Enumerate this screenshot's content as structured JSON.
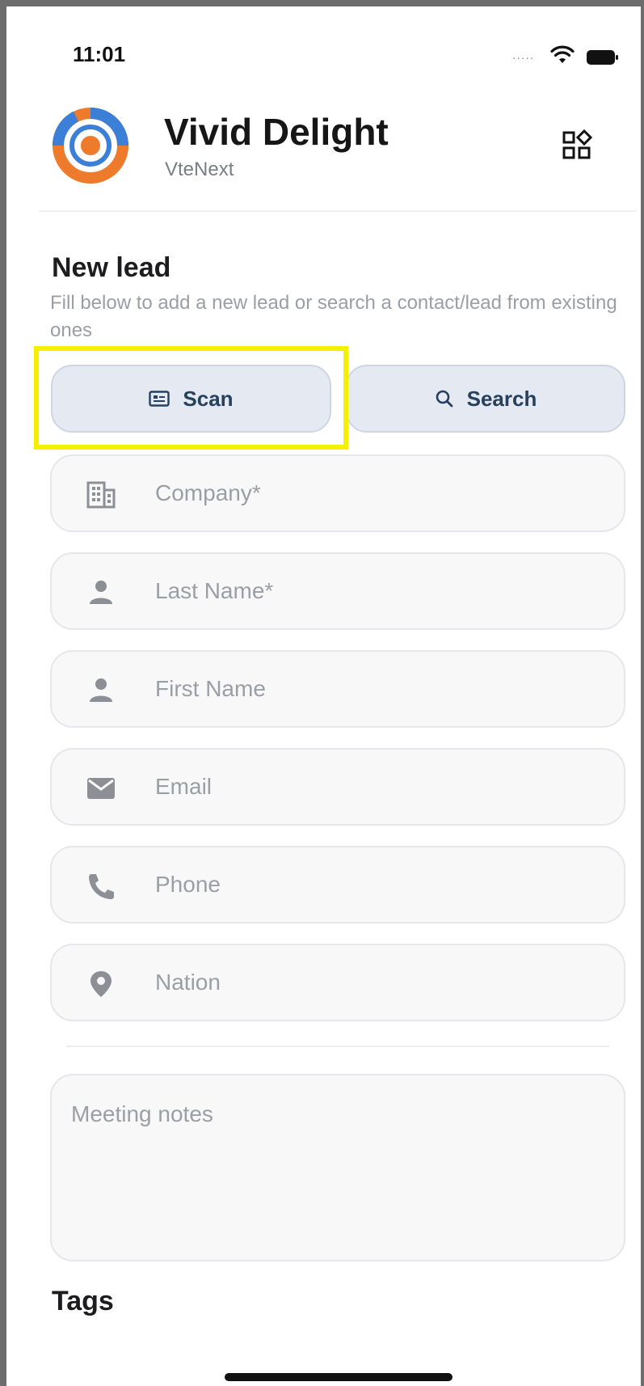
{
  "status_bar": {
    "time": "11:01",
    "signal_dots": "....."
  },
  "header": {
    "title": "Vivid Delight",
    "subtitle": "VteNext"
  },
  "section": {
    "title": "New lead",
    "description": "Fill below to add a new lead or search a contact/lead from existing ones"
  },
  "actions": {
    "scan_label": "Scan",
    "search_label": "Search"
  },
  "fields": [
    {
      "placeholder": "Company*",
      "icon": "building-icon"
    },
    {
      "placeholder": "Last Name*",
      "icon": "person-icon"
    },
    {
      "placeholder": "First Name",
      "icon": "person-icon"
    },
    {
      "placeholder": "Email",
      "icon": "mail-icon"
    },
    {
      "placeholder": "Phone",
      "icon": "phone-icon"
    },
    {
      "placeholder": "Nation",
      "icon": "location-pin-icon"
    }
  ],
  "notes": {
    "placeholder": "Meeting notes"
  },
  "tags": {
    "title": "Tags"
  },
  "colors": {
    "button_bg": "#e4e9f2",
    "button_text": "#26405d",
    "highlight": "#f5f000",
    "logo_blue": "#3b7fd6",
    "logo_orange": "#ee7b2c"
  }
}
